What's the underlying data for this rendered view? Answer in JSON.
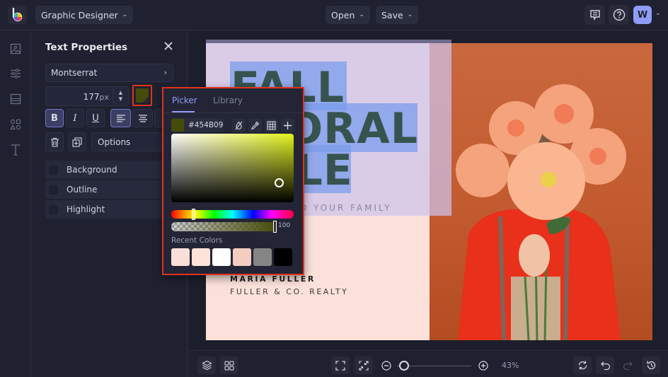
{
  "topbar": {
    "app_logo": "befunky-logo",
    "mode_label": "Graphic Designer",
    "open_label": "Open",
    "save_label": "Save",
    "avatar_initial": "W"
  },
  "left_rail": {
    "items": [
      "image-icon",
      "sliders-icon",
      "layout-icon",
      "shapes-icon",
      "text-icon"
    ]
  },
  "text_properties": {
    "title": "Text Properties",
    "font_family": "Montserrat",
    "font_size": "177",
    "font_size_unit": "px",
    "text_color": "#454B09",
    "format": {
      "bold": "B",
      "italic": "I",
      "underline": "U",
      "bold_active": true,
      "align_left_active": true
    },
    "options_label": "Options",
    "toggles": [
      {
        "label": "Background",
        "checked": false
      },
      {
        "label": "Outline",
        "checked": false
      },
      {
        "label": "Highlight",
        "checked": false
      }
    ]
  },
  "color_picker": {
    "tabs": [
      "Picker",
      "Library"
    ],
    "active_tab": "Picker",
    "hex_value": "#454B09",
    "opacity": "100",
    "hue_color": "#e2f21a",
    "recent_label": "Recent Colors",
    "recent_colors": [
      "#f9dfd8",
      "#fde3da",
      "#ffffff",
      "#f3cdc0",
      "#858585",
      "#000000"
    ]
  },
  "canvas": {
    "headline_lines": [
      "FALL",
      "FLORAL",
      "SALE"
    ],
    "headline_color": "#36534f",
    "tagline": "FOR YOU AND YOUR FAMILY",
    "tagline_visible": "D YOUR FAMILY",
    "agent_name": "MARIA FULLER",
    "company": "FULLER & CO. REALTY",
    "left_bg": "#fbe1da",
    "photo_bg": "#c9683e"
  },
  "bottombar": {
    "zoom_percent": "43%",
    "zoom_value": 0.05
  }
}
